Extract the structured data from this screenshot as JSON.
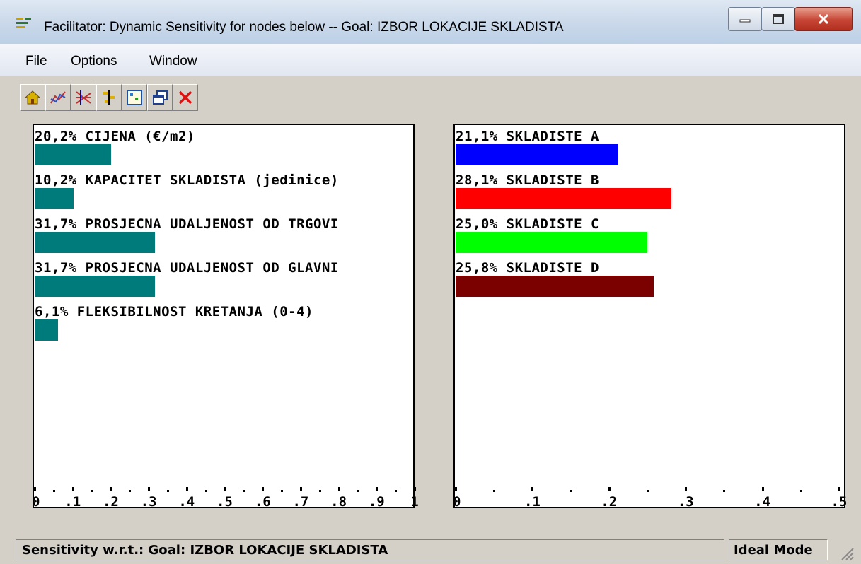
{
  "window": {
    "title": "Facilitator: Dynamic Sensitivity for nodes below -- Goal: IZBOR LOKACIJE SKLADISTA",
    "minimize_icon": "minimize-icon",
    "maximize_icon": "maximize-icon",
    "close_icon": "close-icon"
  },
  "menu": {
    "file": "File",
    "options": "Options",
    "window": "Window"
  },
  "toolbar": {
    "icons": [
      "home-icon",
      "performance-graph-icon",
      "gradient-graph-icon",
      "head-to-head-icon",
      "two-d-plot-icon",
      "window-icon",
      "close-icon"
    ]
  },
  "chart_data": [
    {
      "type": "bar",
      "orientation": "horizontal",
      "categories": [
        "CIJENA (€/m2)",
        "KAPACITET SKLADISTA (jedinice)",
        "PROSJECNA UDALJENOST OD TRGOVI",
        "PROSJECNA UDALJENOST OD GLAVNI",
        "FLEKSIBILNOST KRETANJA (0-4)"
      ],
      "values": [
        0.202,
        0.102,
        0.317,
        0.317,
        0.061
      ],
      "labels": [
        "20,2% CIJENA (€/m2)",
        "10,2% KAPACITET SKLADISTA (jedinice)",
        "31,7% PROSJECNA UDALJENOST OD TRGOVI",
        "31,7% PROSJECNA UDALJENOST OD GLAVNI",
        "6,1% FLEKSIBILNOST KRETANJA (0-4)"
      ],
      "colors": [
        "#007b7b",
        "#007b7b",
        "#007b7b",
        "#007b7b",
        "#007b7b"
      ],
      "xlim": [
        0,
        1
      ],
      "ticks": [
        "0",
        ".1",
        ".2",
        ".3",
        ".4",
        ".5",
        ".6",
        ".7",
        ".8",
        ".9",
        "1"
      ]
    },
    {
      "type": "bar",
      "orientation": "horizontal",
      "categories": [
        "SKLADISTE A",
        "SKLADISTE B",
        "SKLADISTE C",
        "SKLADISTE D"
      ],
      "values": [
        0.211,
        0.281,
        0.25,
        0.258
      ],
      "labels": [
        "21,1% SKLADISTE A",
        "28,1% SKLADISTE B",
        "25,0% SKLADISTE C",
        "25,8% SKLADISTE D"
      ],
      "colors": [
        "#0000ff",
        "#ff0000",
        "#00ff00",
        "#7b0000"
      ],
      "xlim": [
        0,
        0.5
      ],
      "ticks": [
        "0",
        ".1",
        ".2",
        ".3",
        ".4",
        ".5"
      ]
    }
  ],
  "status": {
    "left": "Sensitivity w.r.t.: Goal: IZBOR LOKACIJE SKLADISTA",
    "right": "Ideal Mode"
  }
}
